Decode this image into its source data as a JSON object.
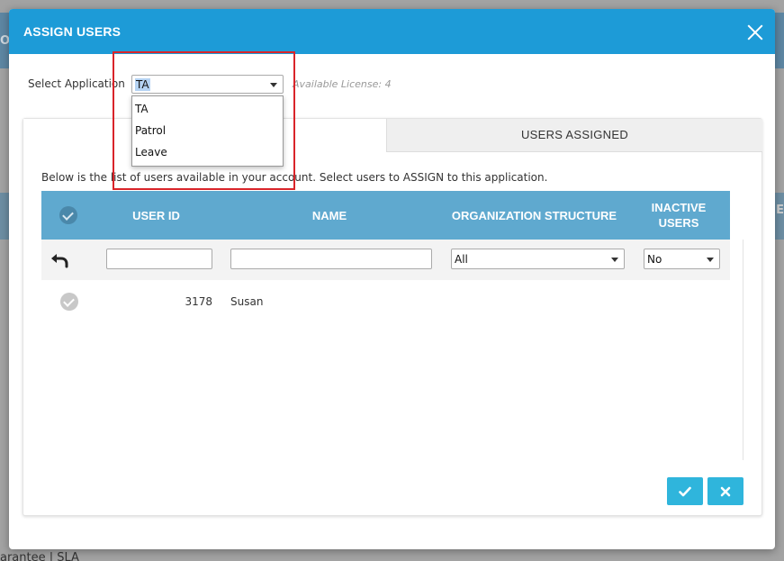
{
  "background": {
    "header_fragment": "OFF",
    "right_fragment": "ME",
    "footer_text": "arantee  |  SLA"
  },
  "modal": {
    "title": "ASSIGN USERS",
    "close_icon": "close-icon"
  },
  "application": {
    "label": "Select Application",
    "selected": "TA",
    "options": [
      "TA",
      "Patrol",
      "Leave"
    ],
    "license_text": "Available License: 4"
  },
  "tabs": {
    "available": "",
    "assigned": "USERS ASSIGNED"
  },
  "instructions": "Below is the list of users available in your account. Select users to ASSIGN to this application.",
  "grid": {
    "columns": {
      "user_id": "USER ID",
      "name": "NAME",
      "org_structure": "ORGANIZATION STRUCTURE",
      "inactive_users_line1": "INACTIVE",
      "inactive_users_line2": "USERS"
    },
    "filters": {
      "user_id": "",
      "name": "",
      "org_structure": "All",
      "inactive": "No"
    },
    "rows": [
      {
        "user_id": "3178",
        "name": "Susan"
      }
    ]
  },
  "colors": {
    "header": "#1d9bd7",
    "grid_header": "#5fa9cf",
    "button": "#2fb5dc",
    "highlight": "#d9242a"
  }
}
